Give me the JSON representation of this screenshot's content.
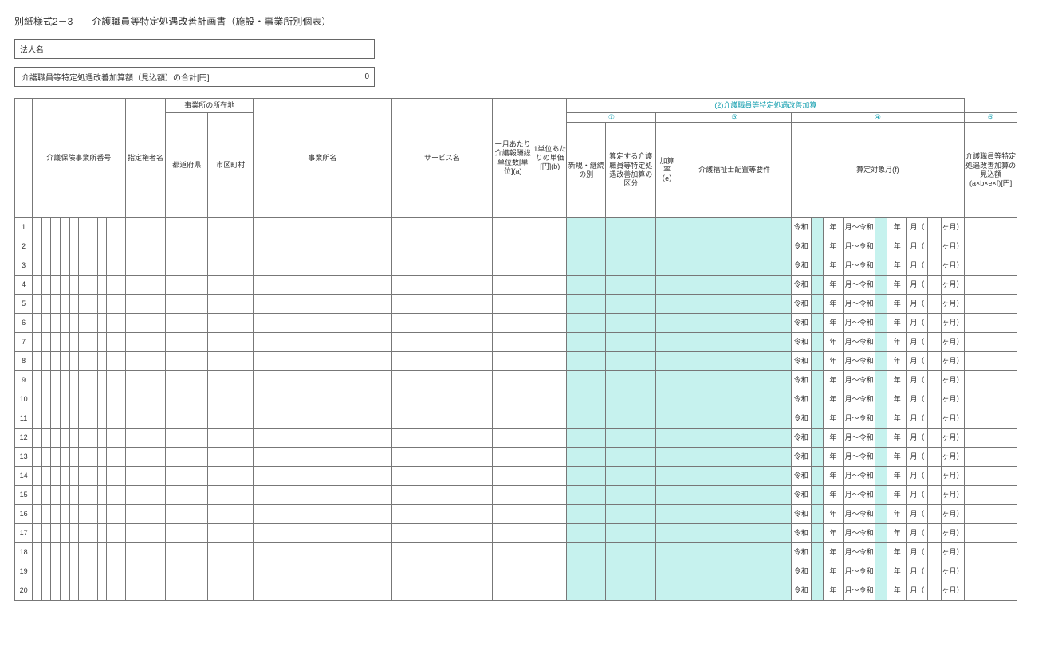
{
  "title": "別紙様式2－3　　介護職員等特定処遇改善計画書（施設・事業所別個表）",
  "houjin_label": "法人名",
  "houjin_value": "",
  "sum_label": "介護職員等特定処遇改善加算額（見込額）の合計[円]",
  "sum_value": "0",
  "headers": {
    "jigyoushobangou": "介護保険事業所番号",
    "siteikensha": "指定権者名",
    "shozaichi": "事業所の所在地",
    "pref": "都道府県",
    "city": "市区町村",
    "jname": "事業所名",
    "svc": "サービス名",
    "a": "一月あたり介護報酬総単位数[単位](a)",
    "b": "1単位あたりの単価[円](b)",
    "section2": "(2)介護職員等特定処遇改善加算",
    "sub1": "①",
    "sub3": "③",
    "sub4": "④",
    "sub5": "⑤",
    "shinki": "新規・継続の別",
    "kubun": "算定する介護職員等特定処遇改善加算の区分",
    "e": "加算率（e）",
    "req": "介護福祉士配置等要件",
    "monthrange": "算定対象月(f)",
    "amount": "介護職員等特定処遇改善加算の見込額(a×b×e×f)[円]"
  },
  "month_labels": {
    "reiwa": "令和",
    "nen": "年",
    "tsuki_reiwa": "月～令和",
    "tsuki_paren": "月（",
    "kagetsu": "ヶ月）"
  },
  "row_numbers": [
    "1",
    "2",
    "3",
    "4",
    "5",
    "6",
    "7",
    "8",
    "9",
    "10",
    "11",
    "12",
    "13",
    "14",
    "15",
    "16",
    "17",
    "18",
    "19",
    "20"
  ]
}
